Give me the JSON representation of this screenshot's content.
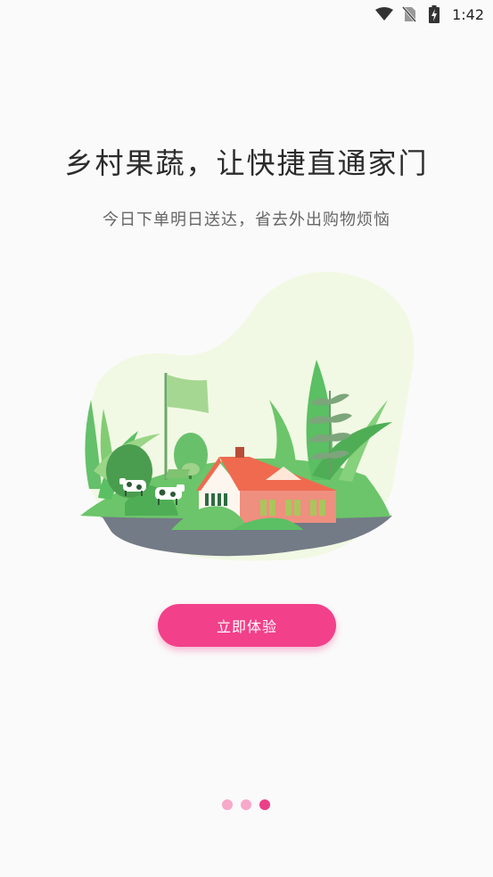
{
  "status_bar": {
    "time": "1:42",
    "icons": [
      "wifi-icon",
      "no-sim-icon",
      "battery-charging-icon"
    ]
  },
  "onboarding": {
    "title": "乡村果蔬，让快捷直通家门",
    "subtitle": "今日下单明日送达，省去外出购物烦恼",
    "illustration": "rural-farmhouse-illustration",
    "cta_label": "立即体验"
  },
  "pager": {
    "total": 3,
    "active_index": 2
  },
  "colors": {
    "accent": "#f2408a",
    "dot_inactive": "#f7a8cb",
    "dot_active": "#ec3f87",
    "leaf_green": "#5bbf63",
    "roof_red": "#ef6a4f",
    "wall_salmon": "#ef8f7f",
    "ground_gray": "#737b86",
    "blob_bg": "#f1f9e4"
  }
}
